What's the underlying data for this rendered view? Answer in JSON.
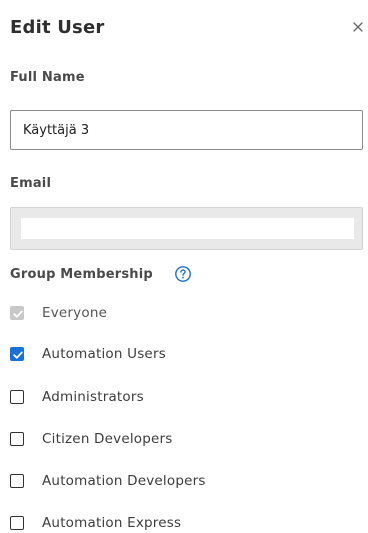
{
  "dialog": {
    "title": "Edit User",
    "close_icon": "close-icon"
  },
  "form": {
    "full_name": {
      "label": "Full Name",
      "value": "Käyttäjä 3"
    },
    "email": {
      "label": "Email",
      "value": "",
      "disabled": true
    },
    "group_membership": {
      "label": "Group Membership",
      "help_icon": "question-circle-icon",
      "groups": [
        {
          "label": "Everyone",
          "checked": true,
          "disabled": true
        },
        {
          "label": "Automation Users",
          "checked": true,
          "disabled": false
        },
        {
          "label": "Administrators",
          "checked": false,
          "disabled": false
        },
        {
          "label": "Citizen Developers",
          "checked": false,
          "disabled": false
        },
        {
          "label": "Automation Developers",
          "checked": false,
          "disabled": false
        },
        {
          "label": "Automation Express",
          "checked": false,
          "disabled": false
        }
      ]
    }
  },
  "colors": {
    "accent": "#1b72d6",
    "disabled_check": "#c8c8c8",
    "title_text": "#2f2f2f"
  }
}
